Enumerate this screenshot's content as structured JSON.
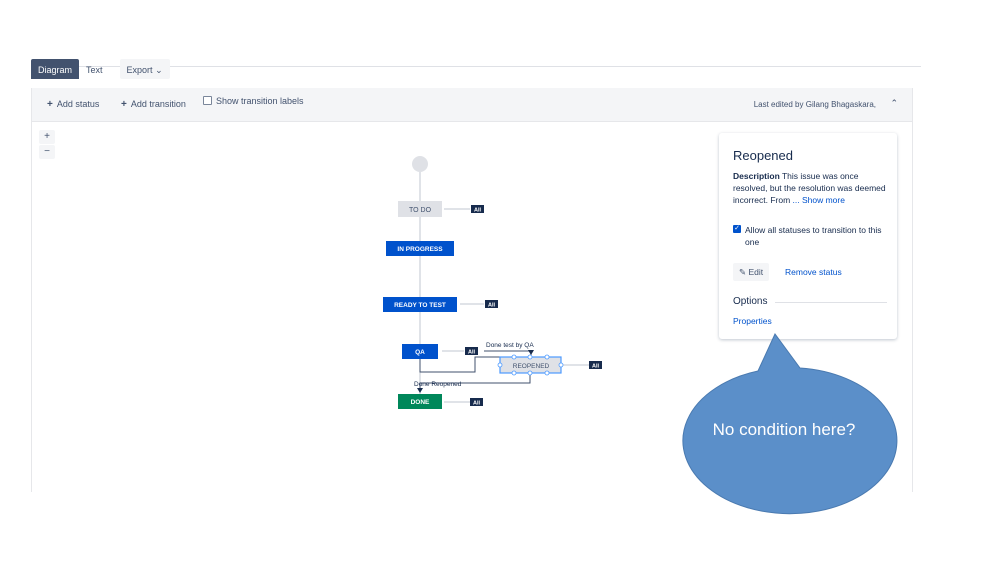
{
  "tabs": {
    "diagram": "Diagram",
    "text": "Text",
    "export": "Export"
  },
  "toolbar": {
    "add_status": "Add status",
    "add_transition": "Add transition",
    "show_transition_labels": "Show transition labels",
    "last_edited": "Last edited by Gilang Bhagaskara,",
    "collapse_glyph": "⌃"
  },
  "zoom": {
    "in": "+",
    "out": "−"
  },
  "diagram": {
    "nodes": {
      "todo": "TO DO",
      "in_progress": "IN PROGRESS",
      "ready_to_test": "READY TO TEST",
      "qa": "QA",
      "reopened": "REOPENED",
      "done": "DONE"
    },
    "all_badge": "All",
    "transitions": {
      "done_test_by_qa": "Done test by QA",
      "done_reopened": "Done Reopened"
    },
    "colors": {
      "gray": "#dfe1e6",
      "blue": "#0052cc",
      "green": "#00875a",
      "navy": "#172b4d"
    }
  },
  "panel": {
    "title": "Reopened",
    "description_label": "Description",
    "description_text": " This issue was once resolved, but the resolution was deemed incorrect. From",
    "show_more": "... Show more",
    "allow_all": "Allow all statuses to transition to this one",
    "edit": "Edit",
    "remove_status": "Remove status",
    "options": "Options",
    "properties": "Properties"
  },
  "callout": {
    "text": "No condition here?",
    "color": "#5b8fc9"
  }
}
